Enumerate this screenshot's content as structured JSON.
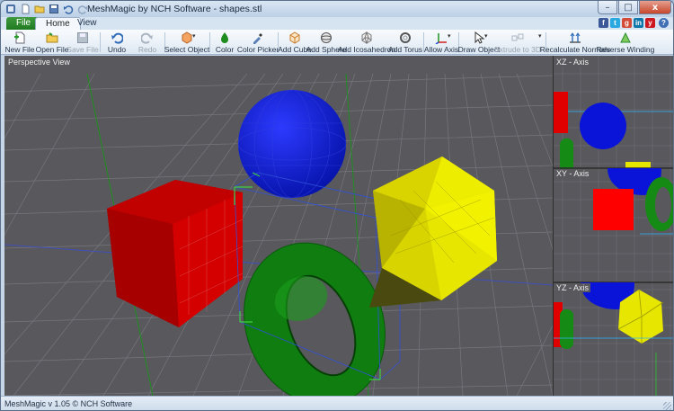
{
  "app": {
    "title": "MeshMagic by NCH Software - shapes.stl",
    "status": "MeshMagic v 1.05 © NCH Software"
  },
  "window_controls": {
    "minimize": "–",
    "maximize": "□",
    "close": "x"
  },
  "tabs": [
    {
      "label": "File"
    },
    {
      "label": "Home"
    },
    {
      "label": "View"
    }
  ],
  "ribbon": {
    "new_file": "New File",
    "open_file": "Open File",
    "save_file": "Save File",
    "undo": "Undo",
    "redo": "Redo",
    "select_object": "Select Object",
    "color": "Color",
    "color_picker": "Color Picker",
    "add_cube": "Add Cube",
    "add_sphere": "Add Sphere",
    "add_icosahedron": "Add Icosahedron",
    "add_torus": "Add Torus",
    "allow_axis": "Allow Axis",
    "draw_object": "Draw Object",
    "extrude_3d": "Extrude to 3D",
    "recalculate_normals": "Recalculate Normals",
    "reverse_winding": "Reverse Winding"
  },
  "viewports": {
    "perspective": "Perspective View",
    "xz": "XZ - Axis",
    "xy": "XY - Axis",
    "yz": "YZ - Axis"
  },
  "social": [
    {
      "text": "f",
      "color": "#3b5998"
    },
    {
      "text": "t",
      "color": "#2aa9e0"
    },
    {
      "text": "g",
      "color": "#d44b37"
    },
    {
      "text": "in",
      "color": "#0e76a8"
    },
    {
      "text": "y",
      "color": "#cc181e"
    }
  ],
  "help": "?",
  "colors": {
    "cube": "#d40000",
    "sphere": "#0a14c8",
    "torus": "#0f7d0f",
    "icosahedron": "#e6e600",
    "viewport_bg": "#58585d",
    "grid": "#7a7a80"
  }
}
